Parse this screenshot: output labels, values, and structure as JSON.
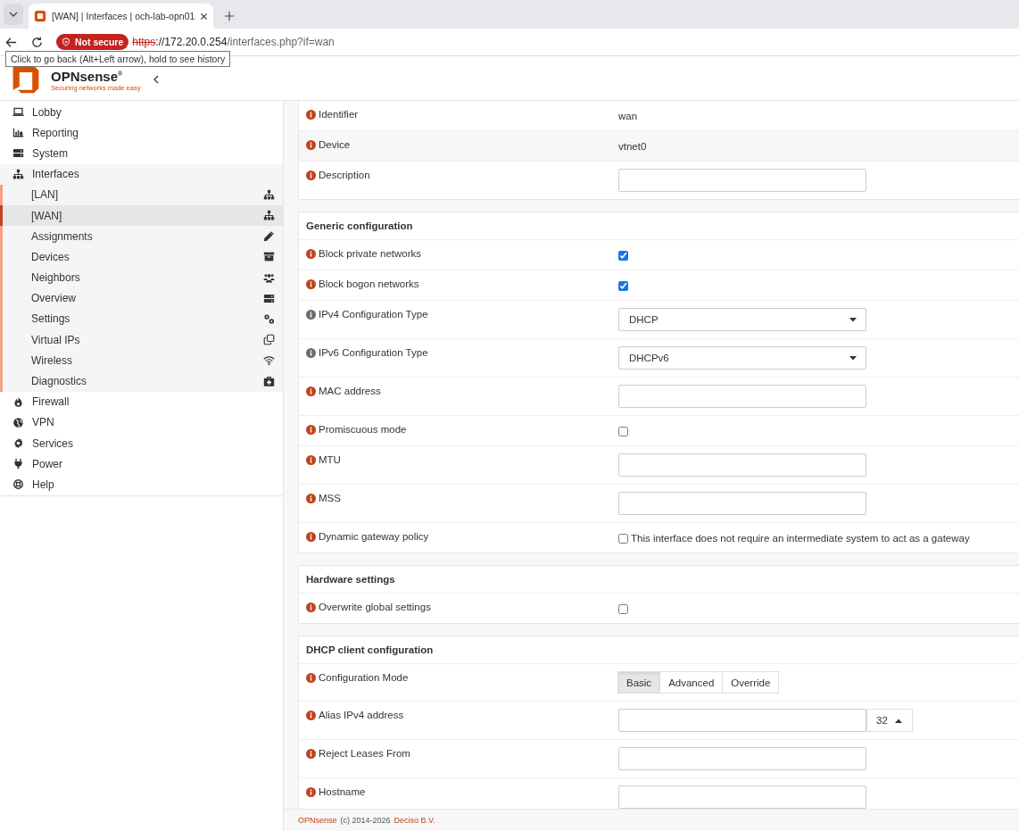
{
  "browser": {
    "tab_title": "[WAN] | Interfaces | och-lab-opn01",
    "security": "Not secure",
    "url_scheme": "https",
    "url_host": "://172.20.0.254",
    "url_path": "/interfaces.php?if=wan",
    "tooltip": "Click to go back (Alt+Left arrow), hold to see history"
  },
  "brand": {
    "name": "OPNsense$^{®}$",
    "tagline": "Securing networks made easy"
  },
  "sidebar": {
    "items": [
      {
        "label": "Lobby"
      },
      {
        "label": "Reporting"
      },
      {
        "label": "System"
      },
      {
        "label": "Interfaces",
        "children": [
          {
            "label": "[LAN]",
            "selected": false
          },
          {
            "label": "[WAN]",
            "selected": true
          },
          {
            "label": "Assignments",
            "selected": false
          },
          {
            "label": "Devices",
            "selected": false
          },
          {
            "label": "Neighbors",
            "selected": false
          },
          {
            "label": "Overview",
            "selected": false
          },
          {
            "label": "Settings",
            "selected": false
          },
          {
            "label": "Virtual IPs",
            "selected": false
          },
          {
            "label": "Wireless",
            "selected": false
          },
          {
            "label": "Diagnostics",
            "selected": false
          }
        ]
      },
      {
        "label": "Firewall"
      },
      {
        "label": "VPN"
      },
      {
        "label": "Services"
      },
      {
        "label": "Power"
      },
      {
        "label": "Help"
      }
    ]
  },
  "sections": [
    {
      "rows": [
        {
          "kind": "static",
          "label": "Identifier",
          "info_muted": false,
          "value": "wan"
        },
        {
          "kind": "static",
          "label": "Device",
          "info_muted": false,
          "value": "vtnet0"
        },
        {
          "kind": "input",
          "label": "Description",
          "info_muted": false
        }
      ]
    },
    {
      "title": "Generic configuration",
      "rows": [
        {
          "kind": "checkbox",
          "label": "Block private networks",
          "info_muted": false,
          "checked": true
        },
        {
          "kind": "checkbox",
          "label": "Block bogon networks",
          "info_muted": false,
          "checked": true
        },
        {
          "kind": "select",
          "label": "IPv4 Configuration Type",
          "info_muted": true,
          "value": "DHCP"
        },
        {
          "kind": "select",
          "label": "IPv6 Configuration Type",
          "info_muted": true,
          "value": "DHCPv6"
        },
        {
          "kind": "input",
          "label": "MAC address",
          "info_muted": false
        },
        {
          "kind": "checkbox",
          "label": "Promiscuous mode",
          "info_muted": false,
          "checked": false
        },
        {
          "kind": "input",
          "label": "MTU",
          "info_muted": false
        },
        {
          "kind": "input",
          "label": "MSS",
          "info_muted": false
        },
        {
          "kind": "checkbox",
          "label": "Dynamic gateway policy",
          "info_muted": false,
          "checked": false,
          "text": "This interface does not require an intermediate system to act as a gateway"
        }
      ]
    },
    {
      "title": "Hardware settings",
      "rows": [
        {
          "kind": "checkbox",
          "label": "Overwrite global settings",
          "info_muted": false,
          "checked": false
        }
      ]
    },
    {
      "title": "DHCP client configuration",
      "rows": [
        {
          "kind": "segmented",
          "label": "Configuration Mode",
          "info_muted": false,
          "options": [
            {
              "label": "Basic",
              "selected": true
            },
            {
              "label": "Advanced",
              "selected": false
            },
            {
              "label": "Override",
              "selected": false
            }
          ]
        },
        {
          "kind": "input_select",
          "label": "Alias IPv4 address",
          "info_muted": false,
          "select_value": "32"
        },
        {
          "kind": "input",
          "label": "Reject Leases From",
          "info_muted": false
        },
        {
          "kind": "input",
          "label": "Hostname",
          "info_muted": false
        }
      ]
    }
  ],
  "footer": [
    {
      "text": "OPNsense",
      "kind": "link"
    },
    {
      "text": "(c) 2014-2026",
      "kind": "text"
    },
    {
      "text": "Deciso B.V.",
      "kind": "link"
    }
  ]
}
